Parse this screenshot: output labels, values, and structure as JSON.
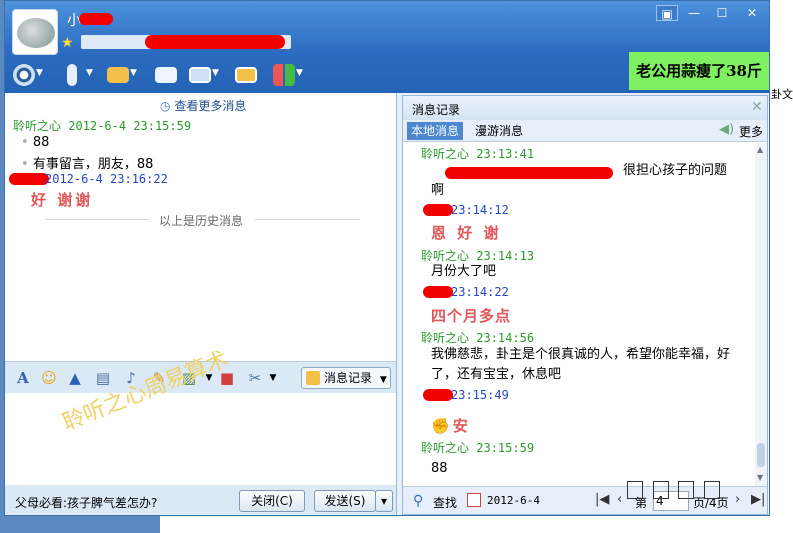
{
  "window": {
    "buttons": {
      "menu": "▣",
      "minimize": "—",
      "maximize": "☐",
      "close": "✕"
    }
  },
  "ad_banner": "老公用蒜瘦了38斤",
  "desktop_text": "卦文",
  "chat": {
    "more_history": "查看更多消息",
    "messages": [
      {
        "sender": "聆听之心",
        "time": "2012-6-4 23:15:59",
        "lines": [
          "88",
          "有事留言，朋友，88"
        ]
      },
      {
        "sender": "",
        "time": "2012-6-4 23:16:22",
        "lines": [
          "好 谢谢"
        ]
      }
    ],
    "history_divider": "以上是历史消息"
  },
  "format_toolbar": {
    "message_record": "消息记录"
  },
  "input": {
    "watermark": "聆听之心周易算术"
  },
  "bottom": {
    "ad_link": "父母必看:孩子脾气差怎办?",
    "close_button": "关闭(C)",
    "send_button": "发送(S)",
    "send_dropdown": "▾"
  },
  "history_panel": {
    "title": "消息记录",
    "tabs": {
      "local": "本地消息",
      "roam": "漫游消息"
    },
    "more": "更多",
    "entries": [
      {
        "sender": "聆听之心",
        "time": "23:13:41",
        "text": "很担心孩子的问题啊",
        "style": "normal"
      },
      {
        "sender": "",
        "time": "23:14:12",
        "text": "恩 好 谢",
        "style": "red"
      },
      {
        "sender": "聆听之心",
        "time": "23:14:13",
        "text": "月份大了吧",
        "style": "normal"
      },
      {
        "sender": "",
        "time": "23:14:22",
        "text": "四个月多点",
        "style": "red"
      },
      {
        "sender": "聆听之心",
        "time": "23:14:56",
        "text": "我佛慈悲，卦主是个很真诚的人，希望你能幸福，好了，还有宝宝，休息吧",
        "style": "normal"
      },
      {
        "sender": "",
        "time": "23:15:49",
        "text": "安",
        "style": "red"
      },
      {
        "sender": "聆听之心",
        "time": "23:15:59",
        "text": "88",
        "style": "normal"
      }
    ],
    "footer": {
      "find": "查找",
      "date": "2012-6-4",
      "page_prefix": "第",
      "page_value": "4",
      "page_suffix": "页/4页"
    }
  }
}
